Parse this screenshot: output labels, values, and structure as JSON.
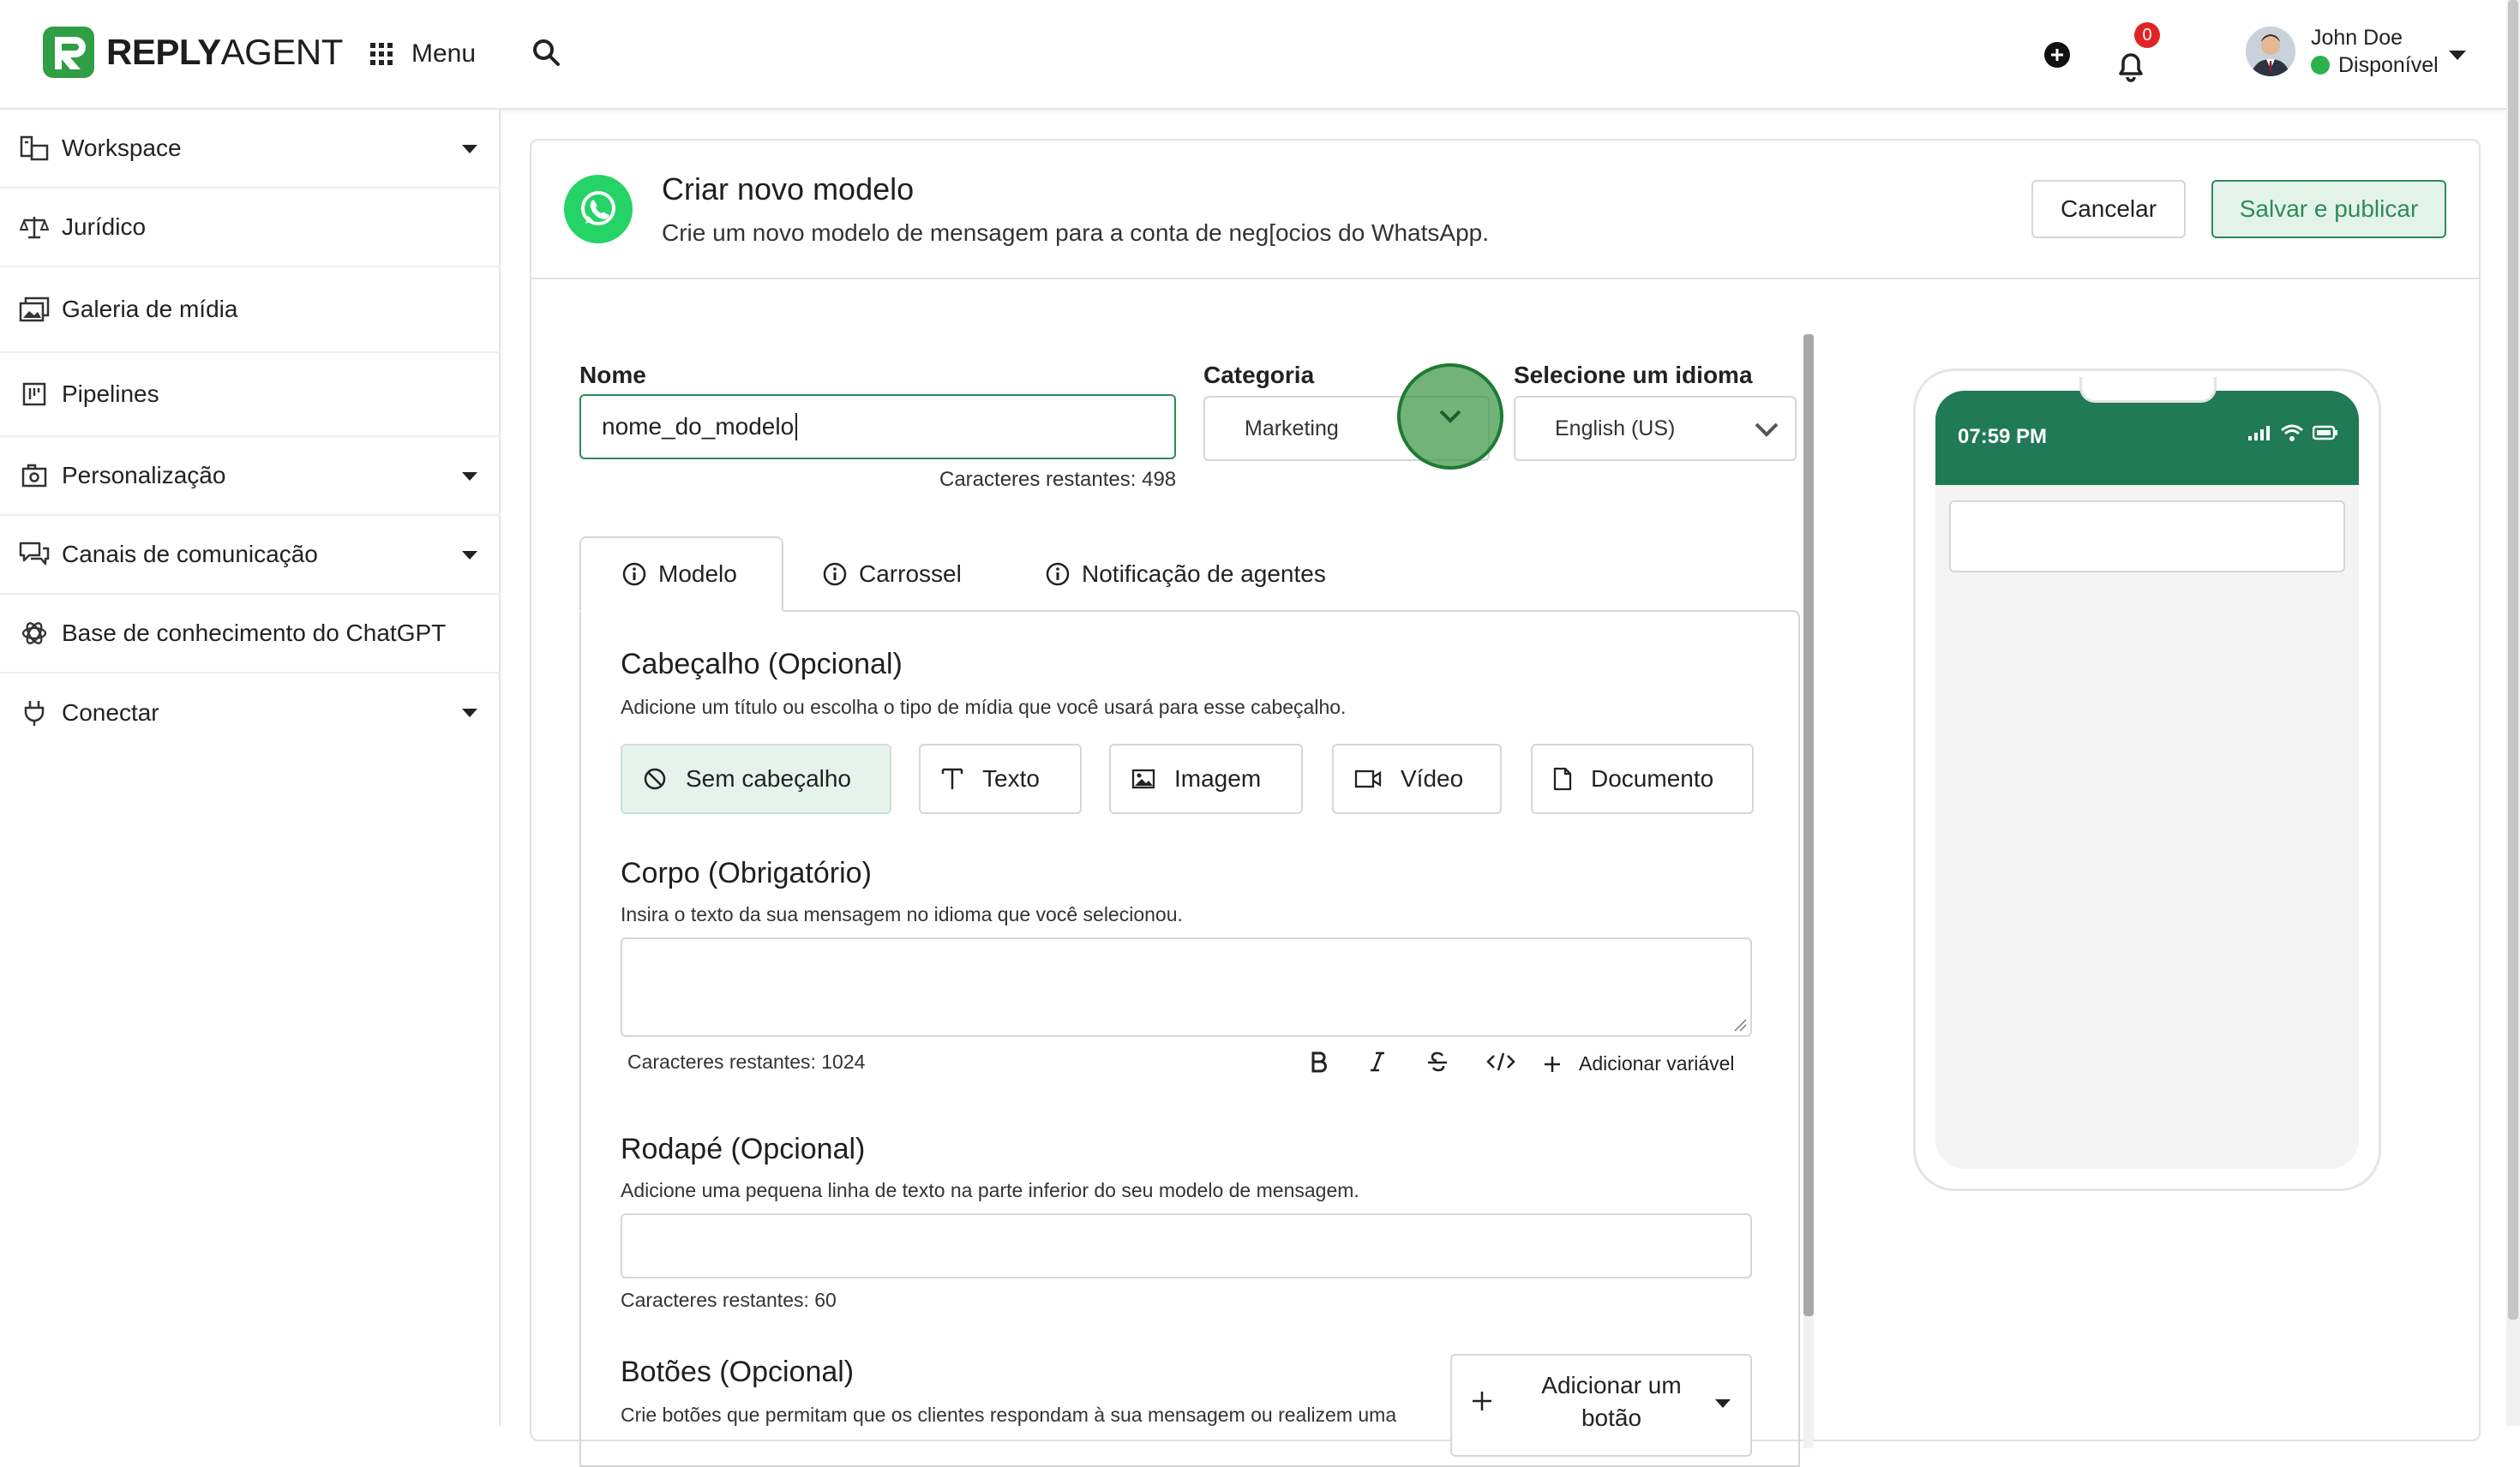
{
  "brand": {
    "logo_bold": "REPLY",
    "logo_light": "AGENT"
  },
  "topbar": {
    "menu_label": "Menu",
    "notification_count": "0",
    "user_name": "John Doe",
    "user_status": "Disponível"
  },
  "sidebar": {
    "items": [
      {
        "label": "Workspace"
      },
      {
        "label": "Jurídico"
      },
      {
        "label": "Galeria de mídia"
      },
      {
        "label": "Pipelines"
      },
      {
        "label": "Personalização"
      },
      {
        "label": "Canais de comunicação"
      },
      {
        "label": "Base de conhecimento do ChatGPT"
      },
      {
        "label": "Conectar"
      }
    ]
  },
  "header": {
    "title": "Criar novo modelo",
    "subtitle": "Crie um novo modelo de mensagem para a conta de neg[ocios do WhatsApp.",
    "cancel_label": "Cancelar",
    "save_label": "Salvar e publicar"
  },
  "form": {
    "name_label": "Nome",
    "name_value": "nome_do_modelo",
    "name_chars": "Caracteres restantes: 498",
    "category_label": "Categoria",
    "category_value": "Marketing",
    "language_label": "Selecione um idioma",
    "language_value": "English (US)"
  },
  "tabs": [
    {
      "label": "Modelo"
    },
    {
      "label": "Carrossel"
    },
    {
      "label": "Notificação de agentes"
    }
  ],
  "header_section": {
    "title": "Cabeçalho (Opcional)",
    "subtitle": "Adicione um título ou escolha o tipo de mídia que você usará para esse cabeçalho.",
    "options": [
      {
        "label": "Sem cabeçalho"
      },
      {
        "label": "Texto"
      },
      {
        "label": "Imagem"
      },
      {
        "label": "Vídeo"
      },
      {
        "label": "Documento"
      }
    ]
  },
  "body_section": {
    "title": "Corpo (Obrigatório)",
    "subtitle": "Insira o texto da sua mensagem no idioma que você selecionou.",
    "chars": "Caracteres restantes: 1024",
    "add_variable": "Adicionar variável"
  },
  "footer_section": {
    "title": "Rodapé (Opcional)",
    "subtitle": "Adicione uma pequena linha de texto na parte inferior do seu modelo de mensagem.",
    "chars": "Caracteres restantes: 60"
  },
  "buttons_section": {
    "title": "Botões (Opcional)",
    "subtitle": "Crie botões que permitam que os clientes respondam à sua mensagem ou realizem uma",
    "add_button": "Adicionar um botão"
  },
  "preview": {
    "time": "07:59 PM"
  },
  "colors": {
    "accent": "#2f8a5a",
    "whatsapp": "#25d366",
    "phone_bar": "#1f7a55",
    "badge": "#e02424"
  }
}
